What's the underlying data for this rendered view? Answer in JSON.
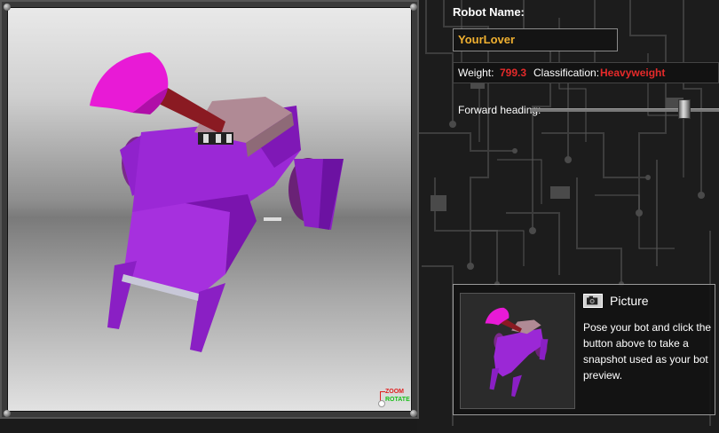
{
  "viewport": {
    "zoom_label": "ZOOM",
    "rotate_label": "ROTATE"
  },
  "robot": {
    "name_label": "Robot Name:",
    "name_value": "YourLover",
    "weight_label": "Weight:",
    "weight_value": "799.3",
    "classification_label": "Classification:",
    "classification_value": "Heavyweight",
    "heading_label": "Forward heading:",
    "heading_value": 0.84
  },
  "picture": {
    "title": "Picture",
    "description": "Pose your bot and click the button above to take a snapshot used as your bot preview."
  },
  "colors": {
    "accent_name": "#f0b030",
    "accent_red": "#e52a2a",
    "bot_purple": "#8a1fc4",
    "bot_pink": "#e81ad6"
  },
  "icons": {
    "camera": "camera-icon",
    "zoom_rotate": "zoom-rotate-icon"
  }
}
